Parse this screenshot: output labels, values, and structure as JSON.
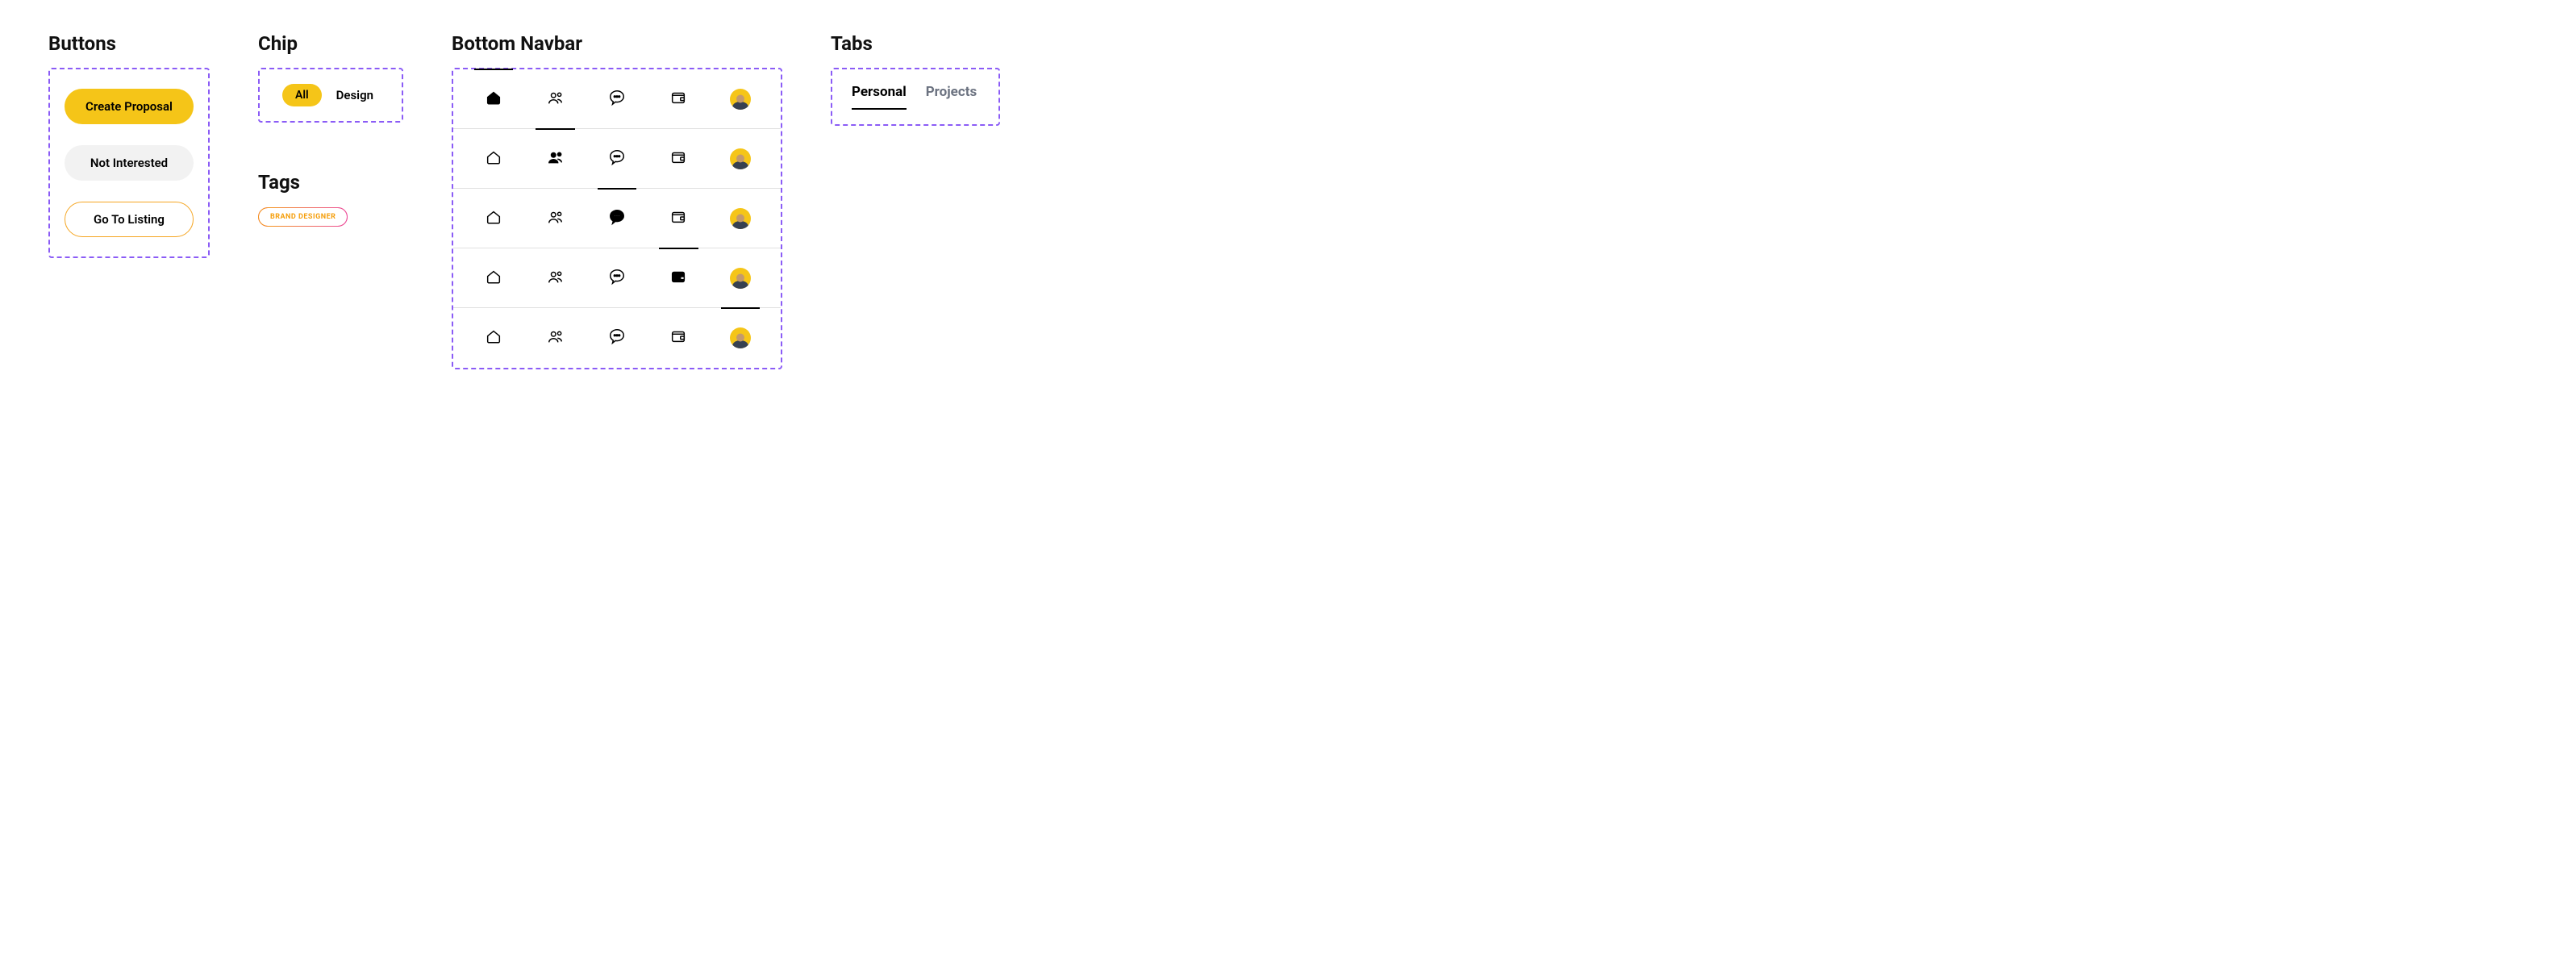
{
  "sections": {
    "buttons": "Buttons",
    "chip": "Chip",
    "tags": "Tags",
    "bottom_navbar": "Bottom Navbar",
    "tabs": "Tabs"
  },
  "buttons": {
    "primary": "Create Proposal",
    "secondary": "Not Interested",
    "outline": "Go To Listing"
  },
  "chips": {
    "all": "All",
    "design": "Design"
  },
  "tag": {
    "label": "BRAND DESIGNER"
  },
  "nav_icons": {
    "home": "home-icon",
    "people": "people-icon",
    "chat": "chat-icon",
    "wallet": "wallet-icon",
    "profile": "profile-avatar"
  },
  "navbars": [
    {
      "active_index": 0
    },
    {
      "active_index": 1
    },
    {
      "active_index": 2
    },
    {
      "active_index": 3
    },
    {
      "active_index": 4
    }
  ],
  "tabs": {
    "personal": "Personal",
    "projects": "Projects",
    "active": "personal"
  }
}
